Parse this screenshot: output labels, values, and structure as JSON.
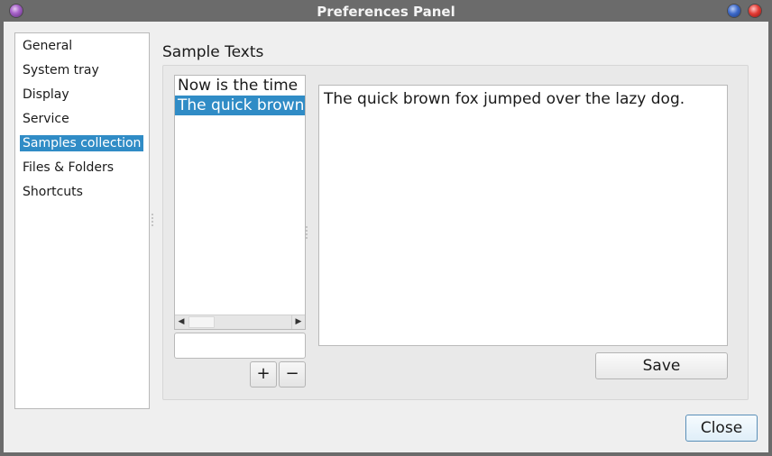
{
  "window": {
    "title": "Preferences Panel"
  },
  "sidebar": {
    "items": [
      {
        "label": "General",
        "selected": false
      },
      {
        "label": "System tray",
        "selected": false
      },
      {
        "label": "Display",
        "selected": false
      },
      {
        "label": "Service",
        "selected": false
      },
      {
        "label": "Samples collection",
        "selected": true
      },
      {
        "label": "Files & Folders",
        "selected": false
      },
      {
        "label": "Shortcuts",
        "selected": false
      }
    ]
  },
  "samples": {
    "section_title": "Sample Texts",
    "list_items": [
      {
        "label": "Now is the time",
        "selected": false
      },
      {
        "label": "The quick brown",
        "selected": true
      }
    ],
    "name_input_value": "",
    "add_label": "+",
    "remove_label": "−",
    "text_content": "The quick brown fox jumped over the lazy dog.",
    "save_label": "Save"
  },
  "footer": {
    "close_label": "Close"
  },
  "colors": {
    "selection": "#308cc6",
    "titlebar": "#6b6b6b",
    "background": "#efefef"
  }
}
